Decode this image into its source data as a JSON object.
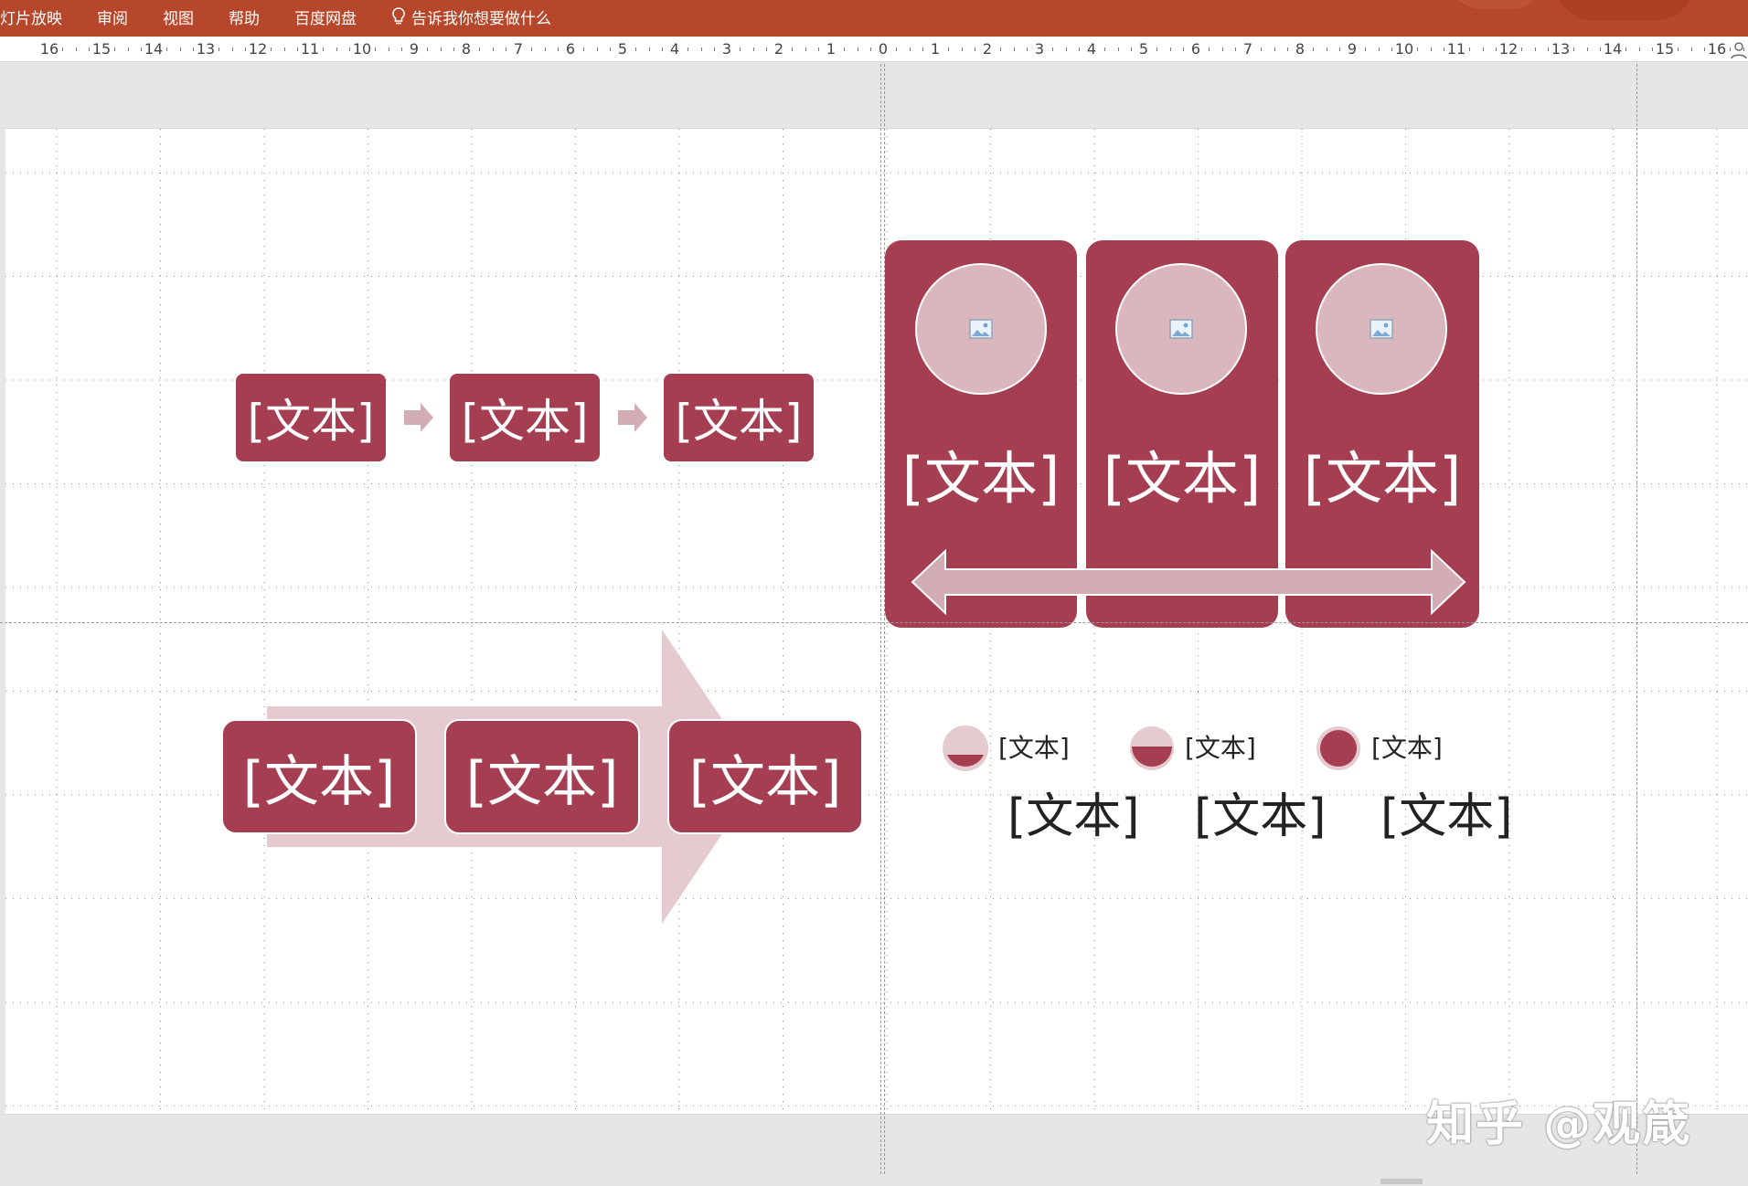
{
  "ribbon": {
    "tabs": [
      "灯片放映",
      "审阅",
      "视图",
      "帮助",
      "百度网盘"
    ],
    "tell_me": "告诉我你想要做什么",
    "color": "#b7472a"
  },
  "ruler": {
    "labels_left": [
      "16",
      "15",
      "14",
      "13",
      "12",
      "11",
      "10",
      "9",
      "8",
      "7",
      "6",
      "5",
      "4",
      "3",
      "2",
      "1"
    ],
    "zero": "0",
    "labels_right": [
      "1",
      "2",
      "3",
      "4",
      "5",
      "6",
      "7",
      "8",
      "9",
      "10",
      "11",
      "12",
      "13",
      "14",
      "15",
      "16"
    ]
  },
  "slide": {
    "accent": "#a63e52",
    "light_accent": "#d9b7bd",
    "process_small": [
      "[文本]",
      "[文本]",
      "[文本]"
    ],
    "columns": [
      "[文本]",
      "[文本]",
      "[文本]"
    ],
    "arrow_process": [
      "[文本]",
      "[文本]",
      "[文本]"
    ],
    "legend": [
      {
        "small": "[文本]",
        "large": "[文本]",
        "fill": "quarter"
      },
      {
        "small": "[文本]",
        "large": "[文本]",
        "fill": "half"
      },
      {
        "small": "[文本]",
        "large": "[文本]",
        "fill": "full"
      }
    ]
  },
  "watermark": "知乎 @观箴"
}
